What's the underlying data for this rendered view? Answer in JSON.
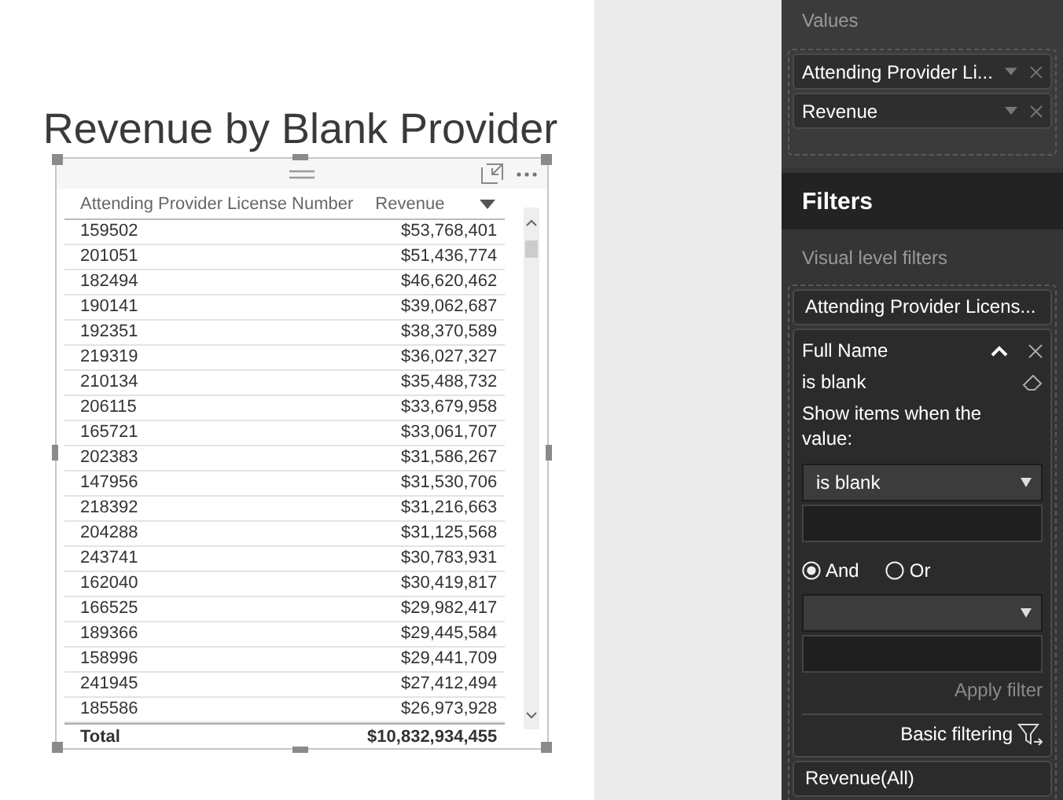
{
  "report_title": "Revenue by Blank Provider",
  "visual": {
    "columns": [
      {
        "label": "Attending Provider License Number",
        "sorted": false
      },
      {
        "label": "Revenue",
        "sorted": true
      }
    ],
    "rows": [
      {
        "license": "159502",
        "revenue": "$53,768,401"
      },
      {
        "license": "201051",
        "revenue": "$51,436,774"
      },
      {
        "license": "182494",
        "revenue": "$46,620,462"
      },
      {
        "license": "190141",
        "revenue": "$39,062,687"
      },
      {
        "license": "192351",
        "revenue": "$38,370,589"
      },
      {
        "license": "219319",
        "revenue": "$36,027,327"
      },
      {
        "license": "210134",
        "revenue": "$35,488,732"
      },
      {
        "license": "206115",
        "revenue": "$33,679,958"
      },
      {
        "license": "165721",
        "revenue": "$33,061,707"
      },
      {
        "license": "202383",
        "revenue": "$31,586,267"
      },
      {
        "license": "147956",
        "revenue": "$31,530,706"
      },
      {
        "license": "218392",
        "revenue": "$31,216,663"
      },
      {
        "license": "204288",
        "revenue": "$31,125,568"
      },
      {
        "license": "243741",
        "revenue": "$30,783,931"
      },
      {
        "license": "162040",
        "revenue": "$30,419,817"
      },
      {
        "license": "166525",
        "revenue": "$29,982,417"
      },
      {
        "license": "189366",
        "revenue": "$29,445,584"
      },
      {
        "license": "158996",
        "revenue": "$29,441,709"
      },
      {
        "license": "241945",
        "revenue": "$27,412,494"
      },
      {
        "license": "185586",
        "revenue": "$26,973,928"
      }
    ],
    "total": {
      "label": "Total",
      "value": "$10,832,934,455"
    }
  },
  "values_section": {
    "title": "Values",
    "fields": [
      "Attending Provider Li...",
      "Revenue"
    ]
  },
  "filters": {
    "title": "Filters",
    "subtitle": "Visual level filters",
    "cards": [
      {
        "kind": "collapsed",
        "label": "Attending Provider Licens..."
      },
      {
        "kind": "expanded",
        "label": "Full Name",
        "summary": "is blank",
        "prompt": "Show items when the value:",
        "condition_1": "is blank",
        "operators": [
          {
            "label": "And",
            "selected": true
          },
          {
            "label": "Or",
            "selected": false
          }
        ],
        "apply": {
          "label": "Apply filter",
          "disabled": true
        },
        "mode_link": "Basic filtering"
      },
      {
        "kind": "collapsed",
        "label": "Revenue(All)"
      }
    ]
  }
}
